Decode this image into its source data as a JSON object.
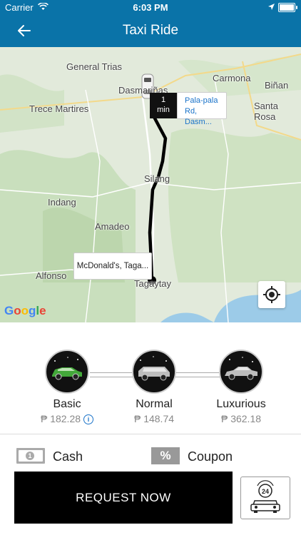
{
  "status_bar": {
    "carrier": "Carrier",
    "time": "6:03 PM"
  },
  "nav": {
    "title": "Taxi Ride"
  },
  "map": {
    "places": [
      "General Trias",
      "Dasmariñas",
      "Carmona",
      "Biñan",
      "Trece Martires",
      "Santa Rosa",
      "Silang",
      "Indang",
      "Amadeo",
      "Alfonso",
      "Tagaytay"
    ],
    "eta": {
      "value": "1",
      "unit": "min"
    },
    "origin": {
      "line1": "Pala-pala",
      "line2": "Rd, Dasm..."
    },
    "destination": "McDonald's, Taga...",
    "attribution": "Google"
  },
  "vehicles": [
    {
      "name": "Basic",
      "price": "₱ 182.28",
      "selected": true
    },
    {
      "name": "Normal",
      "price": "₱ 148.74",
      "selected": false
    },
    {
      "name": "Luxurious",
      "price": "₱ 362.18",
      "selected": false
    }
  ],
  "payment": {
    "cash": "Cash",
    "coupon": "Coupon",
    "cash_icon_digit": "1",
    "coupon_icon_glyph": "%"
  },
  "actions": {
    "request": "REQUEST NOW",
    "schedule_badge": "24"
  },
  "colors": {
    "header": "#0a73a8",
    "selected_car": "#43a83a",
    "route": "#000000"
  }
}
